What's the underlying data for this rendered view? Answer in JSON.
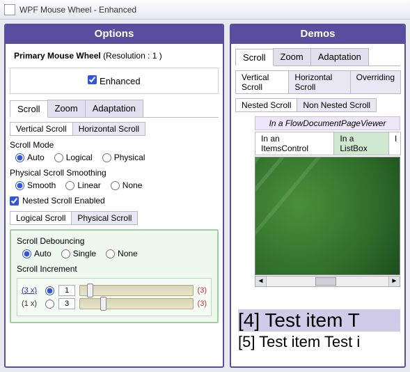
{
  "window": {
    "title": "WPF Mouse Wheel - Enhanced"
  },
  "options": {
    "header": "Options",
    "primary_label": "Primary Mouse Wheel",
    "primary_res": "(Resolution : 1 )",
    "enhanced_label": "Enhanced",
    "tabs": [
      "Scroll",
      "Zoom",
      "Adaptation"
    ],
    "subtabs": [
      "Vertical Scroll",
      "Horizontal Scroll"
    ],
    "scroll_mode": {
      "label": "Scroll Mode",
      "options": [
        "Auto",
        "Logical",
        "Physical"
      ]
    },
    "smoothing": {
      "label": "Physical Scroll Smoothing",
      "options": [
        "Smooth",
        "Linear",
        "None"
      ]
    },
    "nested_enabled": "Nested Scroll Enabled",
    "nested_tabs": [
      "Logical Scroll",
      "Physical Scroll"
    ],
    "debouncing": {
      "label": "Scroll Debouncing",
      "options": [
        "Auto",
        "Single",
        "None"
      ]
    },
    "increment": {
      "label": "Scroll Increment",
      "rows": [
        {
          "mult": "(3 x)",
          "val": "1",
          "max": "(3)"
        },
        {
          "mult": "(1 x)",
          "val": "3",
          "max": "(3)"
        }
      ]
    }
  },
  "demos": {
    "header": "Demos",
    "tabs": [
      "Scroll",
      "Zoom",
      "Adaptation"
    ],
    "subtabs1": [
      "Vertical Scroll",
      "Horizontal Scroll",
      "Overriding"
    ],
    "subtabs2": [
      "Nested Scroll",
      "Non Nested Scroll"
    ],
    "docviewer": "In a FlowDocumentPageViewer",
    "inner_tabs": [
      "In an ItemsControl",
      "In a ListBox",
      "I"
    ],
    "list": {
      "item4": "[4] Test item T",
      "item5": "[5] Test item Test i"
    }
  }
}
